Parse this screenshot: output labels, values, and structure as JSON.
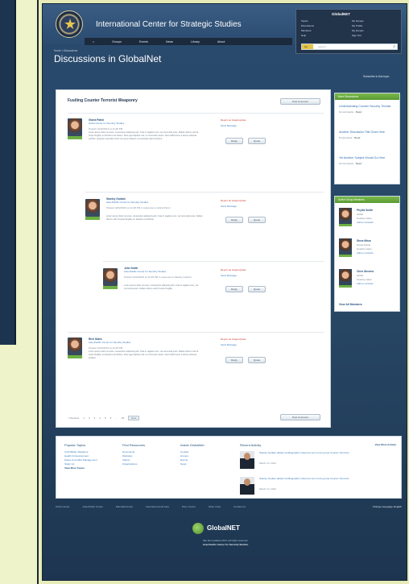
{
  "site": {
    "name": "International Center for Strategic Studies",
    "nav": [
      "Home",
      "Groups",
      "Events",
      "News",
      "Library",
      "About"
    ]
  },
  "globalnet": {
    "title": "GlobalNET",
    "links": [
      "Topics",
      "My Groups",
      "Discussions",
      "My Profile",
      "Members",
      "My Groups",
      "Help",
      "Sign Out"
    ],
    "search_button": "Go",
    "search_placeholder": "Search"
  },
  "breadcrumb": "Home > Discussions",
  "page_title": "Discussions in GlobalNet",
  "subscribe_label": "Subscribe to this topic",
  "discussion": {
    "title": "Fusiling Counter Terrorist Weaponry",
    "post_button": "Post Comment",
    "reply_label": "Reply",
    "quote_label": "Quote",
    "report_label": "Report as Inappropriate",
    "send_label": "Send Message",
    "posts": [
      {
        "name": "Gloria Patrol",
        "org": "Africa Center for Security Studies",
        "date": "Posted 12/22/2013 at 12:48 PM",
        "body": "Lorem ipsum dolor sit amet, consectetur adipiscing elit. Cras in sagittis nunc, vel commodo justo. Nullam dictum velit id turpis fringilla, eu faucibus est finibus. Duis eget dapibus nisl, ut commodo mauris. Sed mollis lorem a lectus vehicula porttitor. Quisque imperdiet tortor nec ipsum aliquet, at venenatis dolor tincidunt."
      },
      {
        "name": "Stanley Godwin",
        "org": "Asia-Pacific Center for Security Studies",
        "date": "Posted 12/22/2013 at 12:48 PM in response to Gloria Patrol",
        "body": "Lorem ipsum dolor sit amet, consectetur adipiscing elit. Cras in sagittis nunc, vel commodo justo. Nullam dictum velit id turpis fringilla, eu faucibus est finibus."
      },
      {
        "name": "John Smith",
        "org": "Asia-Pacific Center for Security Studies",
        "date": "Posted 12/22/2013 at 12:48 PM in response to Stanley Godwin",
        "body": "Lorem ipsum dolor sit amet, consectetur adipiscing elit. Cras in sagittis nunc, vel commodo justo. Nullam dictum velit id turpis fringilla."
      },
      {
        "name": "Rich Gates",
        "org": "Asia-Pacific Center for Security Studies",
        "date": "Posted 12/22/2013 at 12:48 PM",
        "body": "Lorem ipsum dolor sit amet, consectetur adipiscing elit. Cras in sagittis nunc, vel commodo justo. Nullam dictum velit id turpis fringilla, eu faucibus est finibus. Duis eget dapibus nisl, ut commodo mauris. Sed mollis lorem a lectus vehicula porttitor."
      }
    ],
    "pager": {
      "previous": "< Previous",
      "pages": [
        "1",
        "2",
        "3",
        "4",
        "5",
        "6",
        "...",
        "20"
      ],
      "next": "Next"
    }
  },
  "sidebar": {
    "related_title": "More Discussions",
    "related": [
      {
        "title": "Understanding Counter Security Threats",
        "meta": "12 comments",
        "read": "Read"
      },
      {
        "title": "Another Discussion Title Goes Here",
        "meta": "8 comments",
        "read": "Read"
      },
      {
        "title": "Yet Another Subject Would Go Here",
        "meta": "10 comments",
        "read": "Read"
      }
    ],
    "members_title": "Active Group Members",
    "members": [
      {
        "name": "Phyllis Smith",
        "org": "ACSS",
        "country": "Country name",
        "action": "Add to contacts"
      },
      {
        "name": "Steve Mirza",
        "org": "Group Name",
        "country": "Country name",
        "action": "Add to contacts"
      },
      {
        "name": "Chris Stevens",
        "org": "ACSS",
        "country": "Country name",
        "action": "Add to contacts"
      }
    ],
    "view_all": "View All Members"
  },
  "footer": {
    "cols": [
      {
        "heading": "Popular Topics",
        "links": [
          "Civil Military Relations",
          "Health & Development",
          "Peace & Conflict Management",
          "Study Up",
          "View More Topics"
        ]
      },
      {
        "heading": "Find Resources",
        "links": [
          "Documents",
          "Websites",
          "Videos",
          "Organizations"
        ]
      },
      {
        "heading": "Inside GlobalNet",
        "links": [
          "Contact",
          "Groups",
          "Events",
          "News"
        ]
      }
    ],
    "recent_heading": "Recent Activity",
    "see_all": "View More Activity",
    "activity": [
      {
        "text": "Stanley Godwin added a bibliographic reference item to the group Counter Terrorism",
        "date": "March 14, 2014"
      },
      {
        "text": "Stanley Godwin added a bibliographic reference item to the group Counter Terrorism",
        "date": "March 14, 2014"
      }
    ]
  },
  "bottom_nav": [
    "Africa Center",
    "Asia-Pacific Center",
    "Marshall Center",
    "Near East South Asia",
    "Perry Center",
    "Other Links",
    "Contact Us"
  ],
  "bottom_right": "Change Language: English",
  "logo_text": "GlobalNET",
  "copyright_1": "Site last updated 2014. All rights reserved.",
  "copyright_2": "Asia-Pacific Center for Security Studies"
}
